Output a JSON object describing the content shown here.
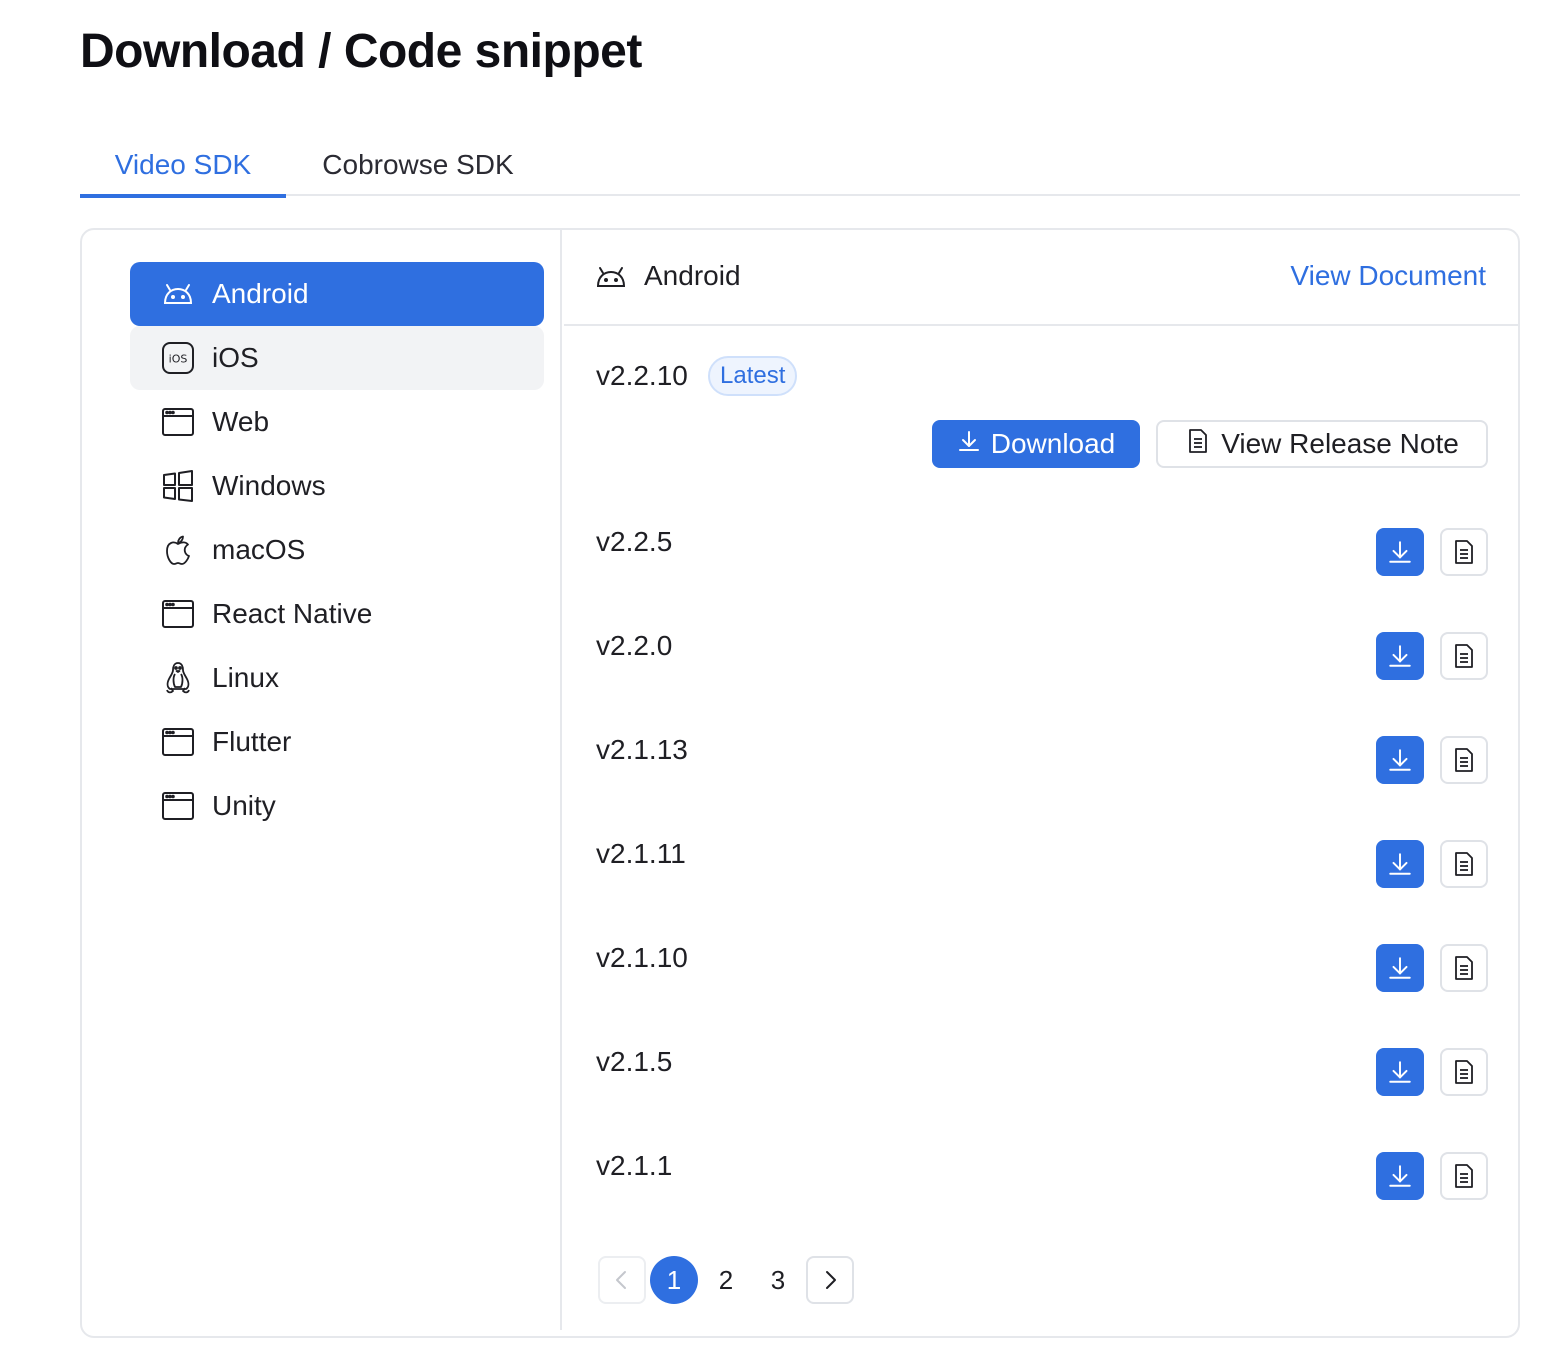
{
  "page": {
    "title": "Download / Code snippet"
  },
  "tabs": [
    {
      "label": "Video SDK",
      "active": true
    },
    {
      "label": "Cobrowse SDK",
      "active": false
    }
  ],
  "sidebar": {
    "items": [
      {
        "label": "Android",
        "icon": "android-icon",
        "state": "active"
      },
      {
        "label": "iOS",
        "icon": "ios-icon",
        "state": "hover"
      },
      {
        "label": "Web",
        "icon": "browser-window-icon",
        "state": ""
      },
      {
        "label": "Windows",
        "icon": "windows-icon",
        "state": ""
      },
      {
        "label": "macOS",
        "icon": "apple-icon",
        "state": ""
      },
      {
        "label": "React Native",
        "icon": "browser-window-icon",
        "state": ""
      },
      {
        "label": "Linux",
        "icon": "linux-icon",
        "state": ""
      },
      {
        "label": "Flutter",
        "icon": "browser-window-icon",
        "state": ""
      },
      {
        "label": "Unity",
        "icon": "browser-window-icon",
        "state": ""
      }
    ]
  },
  "main": {
    "title": "Android",
    "view_document": "View Document",
    "latest": {
      "version": "v2.2.10",
      "badge": "Latest",
      "download_label": "Download",
      "release_note_label": "View Release Note"
    },
    "versions": [
      "v2.2.5",
      "v2.2.0",
      "v2.1.13",
      "v2.1.11",
      "v2.1.10",
      "v2.1.5",
      "v2.1.1"
    ]
  },
  "pagination": {
    "pages": [
      "1",
      "2",
      "3"
    ],
    "current": "1"
  },
  "colors": {
    "accent": "#2f6fe0",
    "border": "#e6e8ec",
    "badge_bg": "#eef4fe"
  }
}
